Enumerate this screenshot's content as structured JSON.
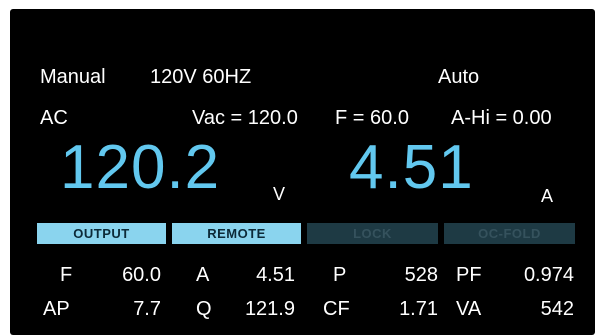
{
  "status": {
    "mode": "Manual",
    "range": "120V 60HZ",
    "control": "Auto",
    "coupling": "AC"
  },
  "setpoints": {
    "vac": "Vac = 120.0",
    "freq": "F = 60.0",
    "a_hi": "A-Hi = 0.00"
  },
  "main": {
    "voltage": "120.2",
    "voltage_unit": "V",
    "current": "4.51",
    "current_unit": "A"
  },
  "indicators": [
    {
      "label": "OUTPUT",
      "active": true
    },
    {
      "label": "REMOTE",
      "active": true
    },
    {
      "label": "LOCK",
      "active": false
    },
    {
      "label": "OC-FOLD",
      "active": false
    }
  ],
  "measurements": {
    "row1": [
      {
        "label": "F",
        "value": "60.0"
      },
      {
        "label": "A",
        "value": "4.51"
      },
      {
        "label": "P",
        "value": "528"
      },
      {
        "label": "PF",
        "value": "0.974"
      }
    ],
    "row2": [
      {
        "label": "AP",
        "value": "7.7"
      },
      {
        "label": "Q",
        "value": "121.9"
      },
      {
        "label": "CF",
        "value": "1.71"
      },
      {
        "label": "VA",
        "value": "542"
      }
    ]
  },
  "colors": {
    "background": "#000000",
    "main_readout": "#62c8ef",
    "indicator_on": "#8ad4ee",
    "indicator_off": "#1e3a44"
  }
}
